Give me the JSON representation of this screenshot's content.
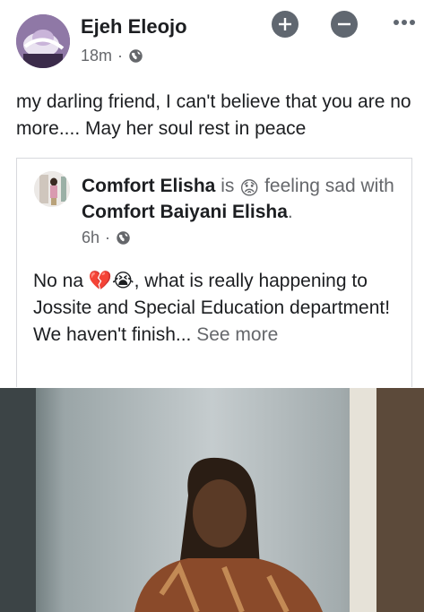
{
  "post": {
    "author": "Ejeh Eleojo",
    "time": "18m",
    "separator": "·",
    "privacy_icon": "globe-icon",
    "text": "my darling friend, I can't believe that you are no more.... May her soul rest in peace",
    "actions": {
      "add_icon": "plus-circle-icon",
      "remove_icon": "minus-circle-icon",
      "more_icon": "more-dots-icon"
    }
  },
  "shared": {
    "author": "Comfort Elisha",
    "is_word": "is",
    "feeling_emoji": "😟",
    "feeling": "feeling sad",
    "with_word": "with",
    "tagged": "Comfort Baiyani Elisha",
    "period": ".",
    "time": "6h",
    "separator": "·",
    "text_start": "No na ",
    "text_emojis": "💔😭",
    "text_rest": ", what is really happening to Jossite and Special Education department! We haven't finish... ",
    "see_more": "See more"
  },
  "colors": {
    "text_primary": "#1c1e21",
    "text_secondary": "#65676b",
    "button_gray": "#606770"
  }
}
